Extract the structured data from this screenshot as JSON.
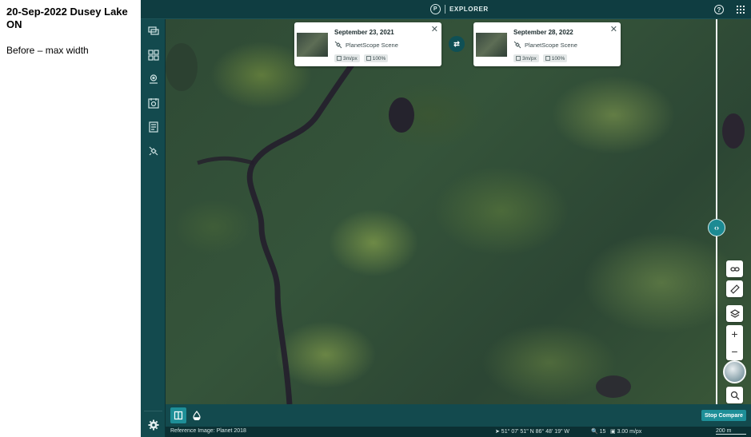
{
  "note": {
    "title": "20-Sep-2022 Dusey Lake ON",
    "subtitle": "Before – max width"
  },
  "header": {
    "logo_letter": "P",
    "app_name": "EXPLORER",
    "help_label": "?"
  },
  "scenes": [
    {
      "date": "September 23, 2021",
      "type": "PlanetScope Scene",
      "resolution": "3m/px",
      "coverage": "100%"
    },
    {
      "date": "September 28, 2022",
      "type": "PlanetScope Scene",
      "resolution": "3m/px",
      "coverage": "100%"
    }
  ],
  "compare": {
    "swap_icon": "⇄",
    "handle_icon": "‹›",
    "stop_label": "Stop Compare"
  },
  "map_controls": {
    "zoom_in": "+",
    "zoom_out": "−"
  },
  "status": {
    "reference": "Reference Image: Planet 2018",
    "coordinates": "➤ 51° 07' 51\" N 86° 48' 19\" W",
    "zoom": "🔍 15",
    "resolution": "▣ 3.00 m/px",
    "scale": "200 m"
  },
  "colors": {
    "app_bg": "#0f3d41",
    "accent": "#1e8f98"
  }
}
